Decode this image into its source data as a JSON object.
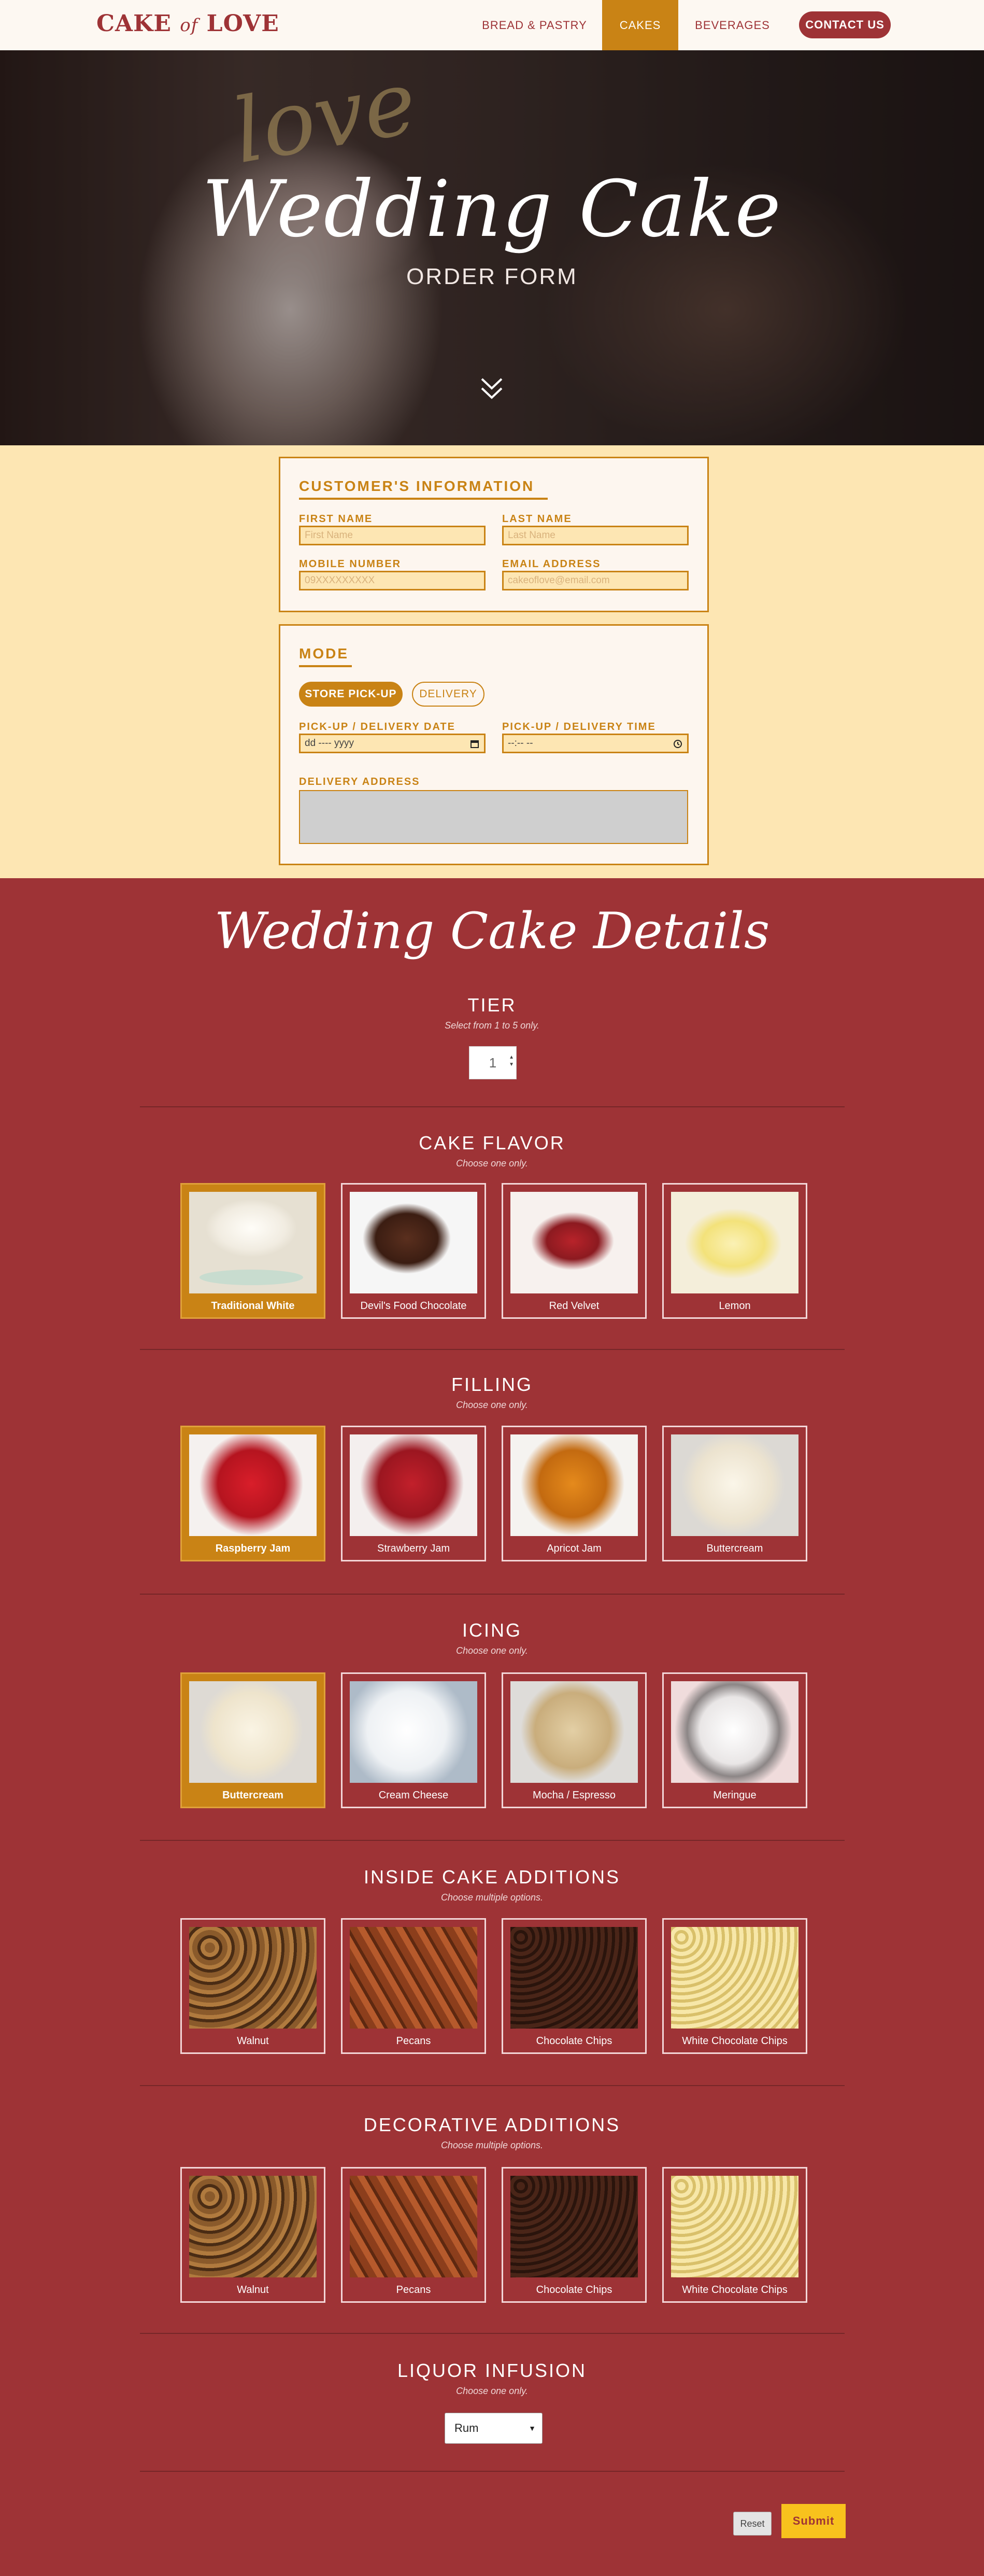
{
  "nav": {
    "logo_left": "CAKE",
    "logo_of": "of",
    "logo_right": "LOVE",
    "links": [
      "BREAD & PASTRY",
      "CAKES",
      "BEVERAGES"
    ],
    "active_link": "CAKES",
    "contact": "CONTACT US"
  },
  "hero": {
    "topper": "love",
    "title": "Wedding Cake",
    "subtitle": "ORDER FORM",
    "scroll_icon": "double-chevron-down-icon"
  },
  "customer": {
    "heading": "CUSTOMER'S INFORMATION",
    "first_name_label": "FIRST NAME",
    "first_name_placeholder": "First Name",
    "last_name_label": "LAST NAME",
    "last_name_placeholder": "Last Name",
    "mobile_label": "MOBILE NUMBER",
    "mobile_placeholder": "09XXXXXXXXX",
    "email_label": "EMAIL ADDRESS",
    "email_placeholder": "cakeoflove@email.com"
  },
  "mode": {
    "heading": "MODE",
    "pickup": "STORE PICK-UP",
    "delivery": "DELIVERY",
    "selected": "STORE PICK-UP",
    "date_label": "PICK-UP / DELIVERY DATE",
    "date_value": "dd ---- yyyy",
    "time_label": "PICK-UP / DELIVERY TIME",
    "time_value": "--:-- --",
    "address_label": "DELIVERY ADDRESS"
  },
  "details": {
    "title": "Wedding Cake Details",
    "tier": {
      "heading": "TIER",
      "sub": "Select from 1 to 5 only.",
      "value": "1"
    },
    "flavor": {
      "heading": "CAKE FLAVOR",
      "sub": "Choose one only.",
      "options": [
        "Traditional White",
        "Devil's Food Chocolate",
        "Red Velvet",
        "Lemon"
      ],
      "selected": 0
    },
    "filling": {
      "heading": "FILLING",
      "sub": "Choose one only.",
      "options": [
        "Raspberry Jam",
        "Strawberry Jam",
        "Apricot Jam",
        "Buttercream"
      ],
      "selected": 0
    },
    "icing": {
      "heading": "ICING",
      "sub": "Choose one only.",
      "options": [
        "Buttercream",
        "Cream Cheese",
        "Mocha / Espresso",
        "Meringue"
      ],
      "selected": 0
    },
    "inside": {
      "heading": "INSIDE CAKE ADDITIONS",
      "sub": "Choose multiple options.",
      "options": [
        "Walnut",
        "Pecans",
        "Chocolate Chips",
        "White Chocolate Chips"
      ]
    },
    "decorative": {
      "heading": "DECORATIVE ADDITIONS",
      "sub": "Choose multiple options.",
      "options": [
        "Walnut",
        "Pecans",
        "Chocolate Chips",
        "White Chocolate Chips"
      ]
    },
    "liquor": {
      "heading": "LIQUOR INFUSION",
      "sub": "Choose one only.",
      "value": "Rum"
    }
  },
  "actions": {
    "reset": "Reset",
    "submit": "Submit"
  },
  "colors": {
    "brand_red": "#9e3336",
    "gold": "#c98315",
    "cream": "#fde6b3",
    "submit_yellow": "#f8c21d"
  }
}
